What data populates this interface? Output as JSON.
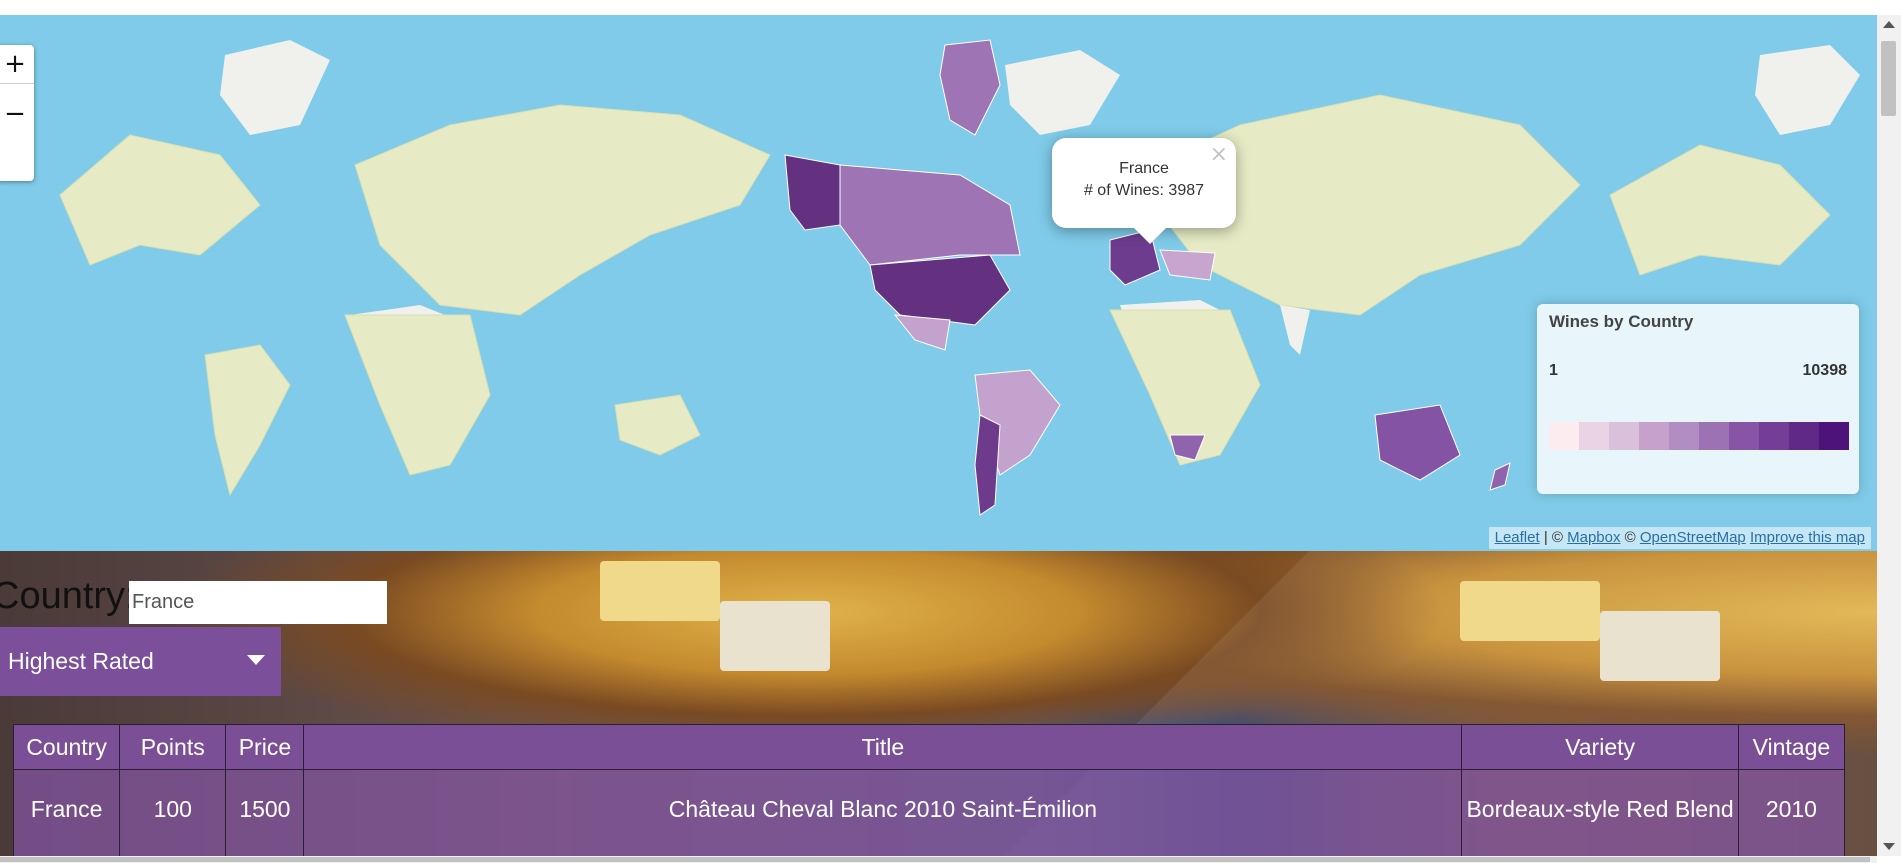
{
  "map": {
    "zoom_in_label": "+",
    "zoom_out_label": "−",
    "popup": {
      "close_label": "×",
      "country": "France",
      "count_text": "# of Wines: 3987"
    },
    "legend": {
      "title": "Wines by Country",
      "min": "1",
      "max": "10398",
      "colors": [
        "#fcecef",
        "#ead3e3",
        "#dbc0db",
        "#c6a1cb",
        "#b08dc3",
        "#9c72b4",
        "#8855a6",
        "#743d97",
        "#602887",
        "#4d137a"
      ]
    },
    "attribution": {
      "leaflet": "Leaflet",
      "sep1": " | © ",
      "mapbox": "Mapbox",
      "sep2": " © ",
      "osm": "OpenStreetMap",
      "improve": "Improve this map"
    },
    "colors": {
      "ocean": "#7fcbe9",
      "land": "#e6ebc5",
      "usa": "#63317f",
      "canada": "#9e74b4",
      "alaska": "#63317f",
      "south_america": "#c3a3cd",
      "argentina": "#6e3b8c",
      "australia": "#8453a4",
      "europe": "#6e3c8e",
      "south_africa": "#8f64ac"
    }
  },
  "filter": {
    "country_label": "Country:",
    "country_value": "France",
    "sort_label": "Highest Rated"
  },
  "table": {
    "headers": [
      "Country",
      "Points",
      "Price",
      "Title",
      "Variety",
      "Vintage"
    ],
    "rows": [
      {
        "country": "France",
        "points": "100",
        "price": "1500",
        "title": "Château Cheval Blanc 2010 Saint-Émilion",
        "variety": "Bordeaux-style Red Blend",
        "vintage": "2010"
      }
    ]
  }
}
